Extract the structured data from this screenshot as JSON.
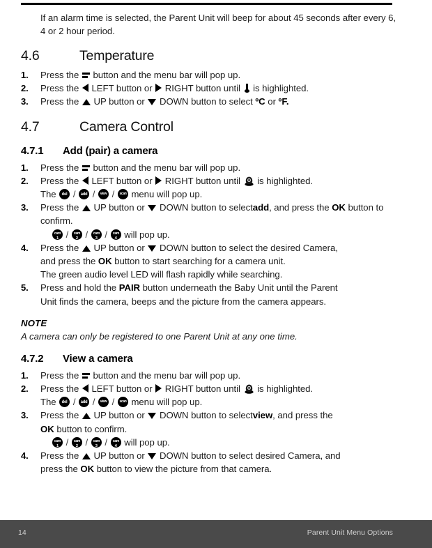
{
  "document": {
    "page_number": "14",
    "footer_title": "Parent Unit Menu Options",
    "footer_bg_color": "#4a4a4a",
    "footer_text_color": "#cfcfcf",
    "rule_color": "#000000"
  },
  "intro": {
    "line1": "If an alarm time is selected, the Parent Unit will beep for about 45 seconds",
    "line2": "after every 6, 4 or 2 hour period."
  },
  "section_46": {
    "number": "4.6",
    "title": "Temperature",
    "steps": [
      {
        "marker": "1.",
        "a": "Press the",
        "b": "button and the menu bar will pop up."
      },
      {
        "marker": "2.",
        "a": "Press the",
        "b": "LEFT button or",
        "c": "RIGHT button until",
        "d": "is highlighted."
      },
      {
        "marker": "3.",
        "a": "Press the",
        "b": "UP button or",
        "c": "DOWN button to select",
        "d": "ºC",
        "e": "or",
        "f": "ºF."
      }
    ]
  },
  "section_47": {
    "number": "4.7",
    "title": "Camera Control"
  },
  "section_471": {
    "number": "4.7.1",
    "title": "Add (pair) a camera",
    "steps": [
      {
        "marker": "1.",
        "a": "Press the",
        "b": "button and the menu bar will pop up."
      },
      {
        "marker": "2.",
        "a": "Press the",
        "b": "LEFT button or",
        "c": "RIGHT button until",
        "d": "is highlighted.",
        "e": "The",
        "f": "menu will pop up."
      },
      {
        "marker": "3.",
        "a": "Press the",
        "b": "UP button or",
        "c": "DOWN button to select",
        "d": "add",
        "e": ", and press the",
        "f": "OK",
        "g": "button to confirm.",
        "h": "will pop up."
      },
      {
        "marker": "4.",
        "a": "Press the",
        "b": "UP button or",
        "c": "DOWN button to select the desired Camera,",
        "d": "and press the",
        "e": "OK",
        "f": "button to start searching for a camera unit.",
        "g": "The green audio level LED will flash rapidly while searching."
      },
      {
        "marker": "5.",
        "a": "Press and hold the",
        "b": "PAIR",
        "c": "button underneath the Baby Unit until the Parent",
        "d": "Unit finds the camera, beeps and the picture from the camera appears."
      }
    ]
  },
  "note": {
    "title": "NOTE",
    "body": "A camera can only be registered to one Parent Unit at any one time."
  },
  "section_472": {
    "number": "4.7.2",
    "title": "View a camera",
    "steps": [
      {
        "marker": "1.",
        "a": "Press the",
        "b": "button and the menu bar will pop up."
      },
      {
        "marker": "2.",
        "a": "Press the",
        "b": "LEFT button or",
        "c": "RIGHT button until",
        "d": "is highlighted.",
        "e": "The",
        "f": "menu will pop up."
      },
      {
        "marker": "3.",
        "a": "Press the",
        "b": "UP button or",
        "c": "DOWN button to select",
        "d": "view",
        "e": ", and press the",
        "f": "OK",
        "g": "button to confirm.",
        "h": "will pop up."
      },
      {
        "marker": "4.",
        "a": "Press the",
        "b": "UP button or",
        "c": "DOWN button to select desired Camera, and",
        "d": "press the",
        "e": "OK",
        "f": "button to view the picture from that camera."
      }
    ]
  },
  "badges": {
    "menu_items": [
      {
        "id": "del-badge",
        "label": "del"
      },
      {
        "id": "add-badge",
        "label": "add"
      },
      {
        "id": "view-badge",
        "label": "view"
      },
      {
        "id": "scan-badge",
        "label": "scan"
      }
    ],
    "cameras": [
      {
        "id": "cam1-badge",
        "label": "cam",
        "number": "1"
      },
      {
        "id": "cam2-badge",
        "label": "cam",
        "number": "2"
      },
      {
        "id": "cam3-badge",
        "label": "cam",
        "number": "3"
      },
      {
        "id": "cam4-badge",
        "label": "cam",
        "number": "4"
      }
    ],
    "separator": "/"
  },
  "icons": {
    "menu": "menu-bar-icon",
    "left": "left-arrow-icon",
    "right": "right-arrow-icon",
    "up": "up-arrow-icon",
    "down": "down-arrow-icon",
    "thermometer": "thermometer-icon",
    "camera": "camera-icon"
  }
}
